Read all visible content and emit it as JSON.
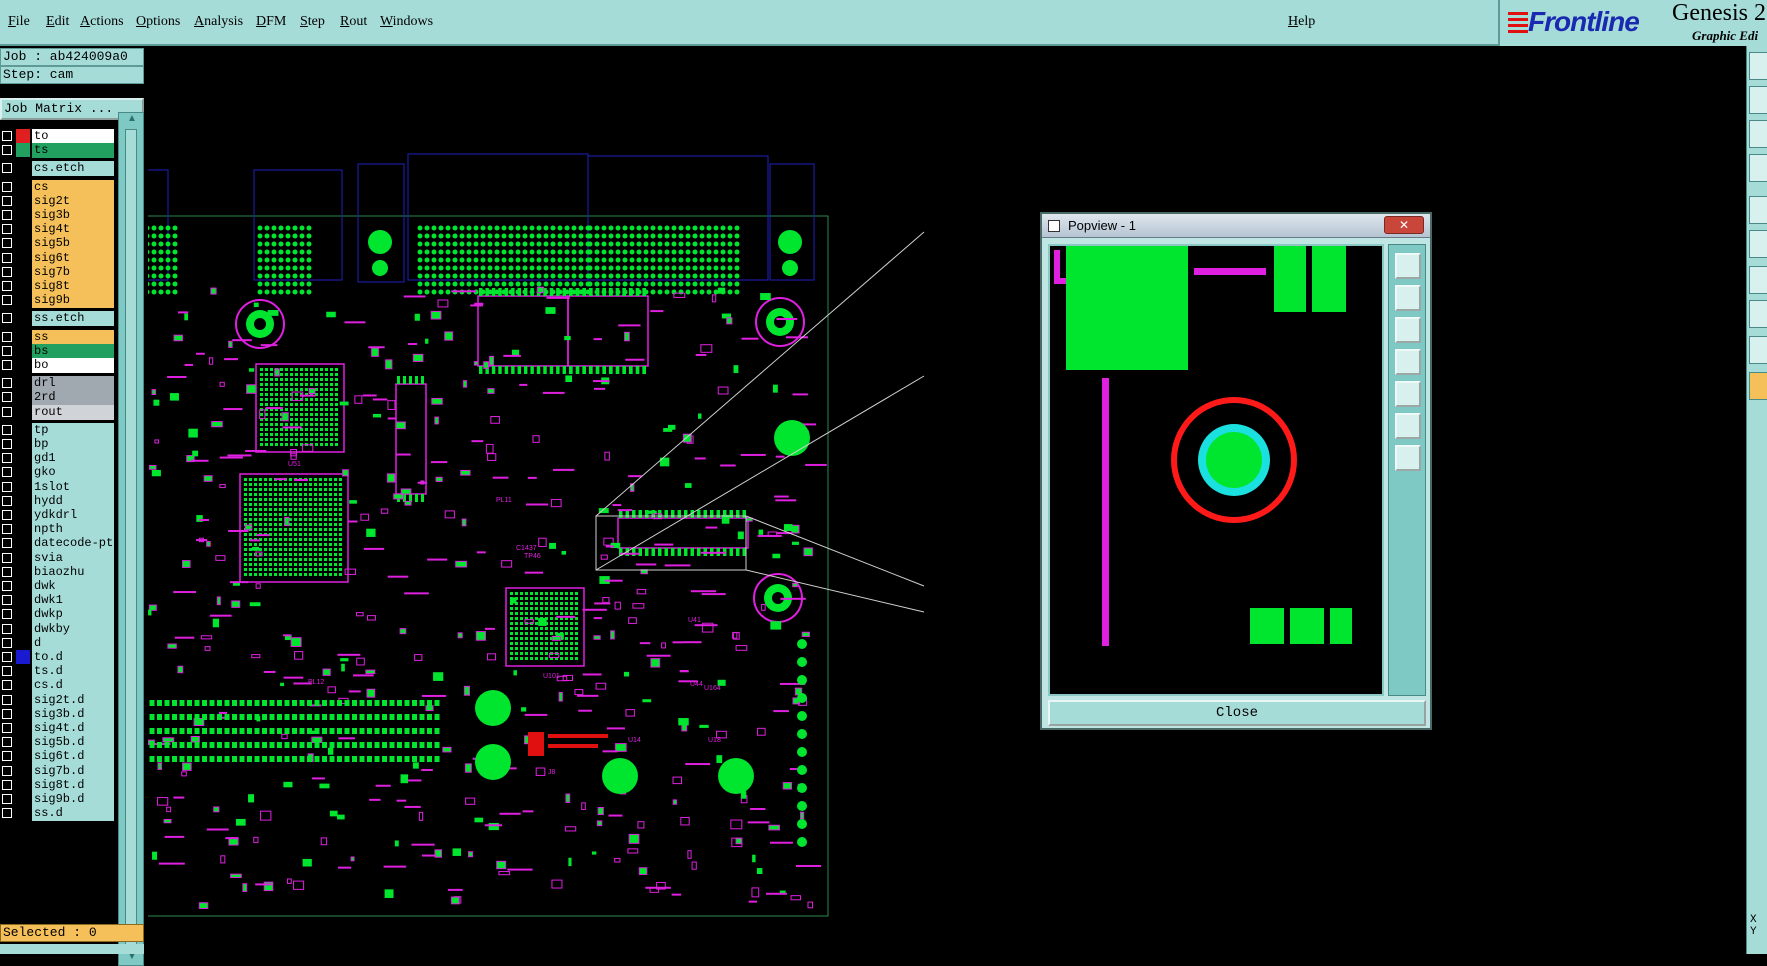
{
  "menubar": {
    "items": [
      "File",
      "Edit",
      "Actions",
      "Options",
      "Analysis",
      "DFM",
      "Step",
      "Rout",
      "Windows"
    ],
    "help": "Help"
  },
  "logo": {
    "brand": "Frontline",
    "product": "Genesis 2",
    "subtitle": "Graphic Edi"
  },
  "job": {
    "label": "Job : ab424009a0",
    "step": "Step: cam",
    "matrix_button": "Job Matrix ..."
  },
  "layers": [
    {
      "name": "to",
      "color": "#ffffff",
      "swatch": "#e02020",
      "ind": "#1a1ad0"
    },
    {
      "name": "ts",
      "color": "#22a060",
      "swatch": "#22a060"
    },
    {
      "name": "cs.etch",
      "color": "#a6dcd8",
      "swatch": "#000000",
      "gap": true
    },
    {
      "name": "cs",
      "color": "#f5c05a",
      "swatch": "#000000",
      "gap": true
    },
    {
      "name": "sig2t",
      "color": "#f5c05a",
      "swatch": "#000000"
    },
    {
      "name": "sig3b",
      "color": "#f5c05a",
      "swatch": "#000000"
    },
    {
      "name": "sig4t",
      "color": "#f5c05a",
      "swatch": "#000000"
    },
    {
      "name": "sig5b",
      "color": "#f5c05a",
      "swatch": "#000000"
    },
    {
      "name": "sig6t",
      "color": "#f5c05a",
      "swatch": "#000000"
    },
    {
      "name": "sig7b",
      "color": "#f5c05a",
      "swatch": "#000000"
    },
    {
      "name": "sig8t",
      "color": "#f5c05a",
      "swatch": "#000000"
    },
    {
      "name": "sig9b",
      "color": "#f5c05a",
      "swatch": "#000000"
    },
    {
      "name": "ss.etch",
      "color": "#a6dcd8",
      "swatch": "#000000",
      "gap": true
    },
    {
      "name": "ss",
      "color": "#f5c05a",
      "swatch": "#000000",
      "gap": true
    },
    {
      "name": "bs",
      "color": "#22a060",
      "swatch": "#000000"
    },
    {
      "name": "bo",
      "color": "#ffffff",
      "swatch": "#000000"
    },
    {
      "name": "drl",
      "color": "#a0a8b0",
      "swatch": "#000000",
      "gap": true
    },
    {
      "name": "2rd",
      "color": "#a0a8b0",
      "swatch": "#000000"
    },
    {
      "name": "rout",
      "color": "#d0d4d8",
      "swatch": "#000000"
    },
    {
      "name": "tp",
      "color": "#a6dcd8",
      "swatch": "#000000",
      "gap": true
    },
    {
      "name": "bp",
      "color": "#a6dcd8",
      "swatch": "#000000"
    },
    {
      "name": "gd1",
      "color": "#a6dcd8",
      "swatch": "#000000"
    },
    {
      "name": "gko",
      "color": "#a6dcd8",
      "swatch": "#000000"
    },
    {
      "name": "1slot",
      "color": "#a6dcd8",
      "swatch": "#000000"
    },
    {
      "name": "hydd",
      "color": "#a6dcd8",
      "swatch": "#000000"
    },
    {
      "name": "ydkdrl",
      "color": "#a6dcd8",
      "swatch": "#000000"
    },
    {
      "name": "npth",
      "color": "#a6dcd8",
      "swatch": "#000000"
    },
    {
      "name": "datecode-pt",
      "color": "#a6dcd8",
      "swatch": "#000000"
    },
    {
      "name": "svia",
      "color": "#a6dcd8",
      "swatch": "#000000"
    },
    {
      "name": "biaozhu",
      "color": "#a6dcd8",
      "swatch": "#000000"
    },
    {
      "name": "dwk",
      "color": "#a6dcd8",
      "swatch": "#000000"
    },
    {
      "name": "dwk1",
      "color": "#a6dcd8",
      "swatch": "#000000"
    },
    {
      "name": "dwkp",
      "color": "#a6dcd8",
      "swatch": "#000000"
    },
    {
      "name": "dwkby",
      "color": "#a6dcd8",
      "swatch": "#000000"
    },
    {
      "name": "d",
      "color": "#a6dcd8",
      "swatch": "#000000"
    },
    {
      "name": "to.d",
      "color": "#a6dcd8",
      "swatch": "#1a1ad0"
    },
    {
      "name": "ts.d",
      "color": "#a6dcd8",
      "swatch": "#000000"
    },
    {
      "name": "cs.d",
      "color": "#a6dcd8",
      "swatch": "#000000"
    },
    {
      "name": "sig2t.d",
      "color": "#a6dcd8",
      "swatch": "#000000"
    },
    {
      "name": "sig3b.d",
      "color": "#a6dcd8",
      "swatch": "#000000"
    },
    {
      "name": "sig4t.d",
      "color": "#a6dcd8",
      "swatch": "#000000"
    },
    {
      "name": "sig5b.d",
      "color": "#a6dcd8",
      "swatch": "#000000"
    },
    {
      "name": "sig6t.d",
      "color": "#a6dcd8",
      "swatch": "#000000"
    },
    {
      "name": "sig7b.d",
      "color": "#a6dcd8",
      "swatch": "#000000"
    },
    {
      "name": "sig8t.d",
      "color": "#a6dcd8",
      "swatch": "#000000"
    },
    {
      "name": "sig9b.d",
      "color": "#a6dcd8",
      "swatch": "#000000"
    },
    {
      "name": "ss.d",
      "color": "#a6dcd8",
      "swatch": "#000000"
    }
  ],
  "status": {
    "selected": "Selected : 0"
  },
  "popview": {
    "title": "Popview - 1",
    "close_x": "✕",
    "close_button": "Close"
  },
  "coords": {
    "xy": "X Y"
  },
  "colors": {
    "pad": "#00e62e",
    "silk": "#e020e0",
    "board": "#000000",
    "highlight": "#ff1a1a",
    "via": "#1ae0e0"
  },
  "board_labels": [
    "U51",
    "U101",
    "PL11",
    "PL12",
    "C1437",
    "TP46",
    "U41",
    "U44",
    "J8",
    "U164",
    "U14",
    "U18"
  ]
}
